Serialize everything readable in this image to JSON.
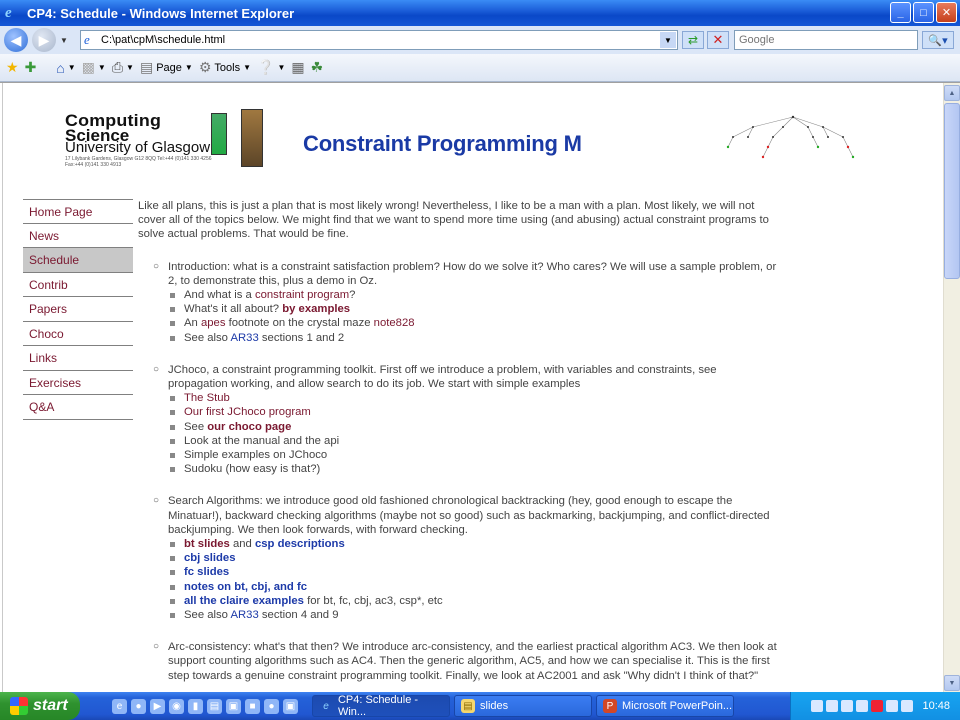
{
  "window": {
    "title": "CP4: Schedule - Windows Internet Explorer",
    "minimize": "_",
    "maximize": "□",
    "close": "✕"
  },
  "toolbar": {
    "address": "C:\\pat\\cpM\\schedule.html",
    "search_placeholder": "Google",
    "page_label": "Page",
    "tools_label": "Tools"
  },
  "header": {
    "logo_line1": "Computing",
    "logo_line2": "Science",
    "logo_line3": "University of Glasgow",
    "logo_small": "17 Lilybank Gardens, Glasgow G12 8QQ Tel:+44 (0)141 330 4256 Fax:+44 (0)141 330 4913",
    "title": "Constraint Programming M"
  },
  "sidebar": {
    "items": [
      {
        "label": "Home Page",
        "active": false
      },
      {
        "label": "News",
        "active": false
      },
      {
        "label": "Schedule",
        "active": true
      },
      {
        "label": "Contrib",
        "active": false
      },
      {
        "label": "Papers",
        "active": false
      },
      {
        "label": "Choco",
        "active": false
      },
      {
        "label": "Links",
        "active": false
      },
      {
        "label": "Exercises",
        "active": false
      },
      {
        "label": "Q&A",
        "active": false
      }
    ]
  },
  "main": {
    "intro": "Like all plans, this is just a plan that is most likely wrong! Nevertheless, I like to be a man with a plan. Most likely, we will not cover all of the topics below. We might find that we want to spend more time using (and abusing) actual constraint programs to solve actual problems. That would be fine.",
    "t1": {
      "text": "Introduction: what is a constraint satisfaction problem? How do we solve it? Who cares? We will use a sample problem, or 2, to demonstrate this, plus a demo in Oz.",
      "i1a": "And what is a ",
      "i1b": "constraint program",
      "i1c": "?",
      "i2a": "What's it all about? ",
      "i2b": "by examples",
      "i3a": "An ",
      "i3b": "apes",
      "i3c": " footnote on the crystal maze ",
      "i3d": "note828",
      "i4a": "See also ",
      "i4b": "AR33",
      "i4c": " sections 1 and 2"
    },
    "t2": {
      "text": "JChoco, a constraint programming toolkit. First off we introduce a problem, with variables and constraints, see propagation working, and allow search to do its job. We start with simple examples",
      "i1": "The Stub",
      "i2": "Our first JChoco program",
      "i3a": "See ",
      "i3b": "our choco page",
      "i4": "Look at the manual and the api",
      "i5": "Simple examples on JChoco",
      "i6": "Sudoku (how easy is that?)"
    },
    "t3": {
      "text": "Search Algorithms: we introduce good old fashioned chronological backtracking (hey, good enough to escape the Minatuar!), backward checking algorithms (maybe not so good) such as backmarking, backjumping, and conflict-directed backjumping. We then look forwards, with forward checking.",
      "i1a": "bt slides",
      "i1b": " and ",
      "i1c": "csp descriptions",
      "i2": "cbj slides",
      "i3": "fc slides",
      "i4": "notes on bt, cbj, and fc",
      "i5a": "all the claire examples",
      "i5b": " for bt, fc, cbj, ac3, csp*, etc",
      "i6a": "See also ",
      "i6b": "AR33",
      "i6c": " section 4 and 9"
    },
    "t4": {
      "text": "Arc-consistency: what's that then? We introduce arc-consistency, and the earliest practical algorithm AC3. We then look at support counting algorithms such as AC4. Then the generic algorithm, AC5, and how we can specialise it. This is the first step towards a genuine constraint programming toolkit. Finally, we look at AC2001 and ask \"Why didn't I think of that?\""
    }
  },
  "taskbar": {
    "start": "start",
    "tasks": [
      {
        "label": "CP4: Schedule - Win...",
        "active": true
      },
      {
        "label": "slides",
        "active": false
      },
      {
        "label": "Microsoft PowerPoin...",
        "active": false
      }
    ],
    "clock": "10:48"
  },
  "colors": {
    "link": "#7a1830",
    "link_blue": "#1d3aa8",
    "title_blue": "#1a3aa5"
  }
}
